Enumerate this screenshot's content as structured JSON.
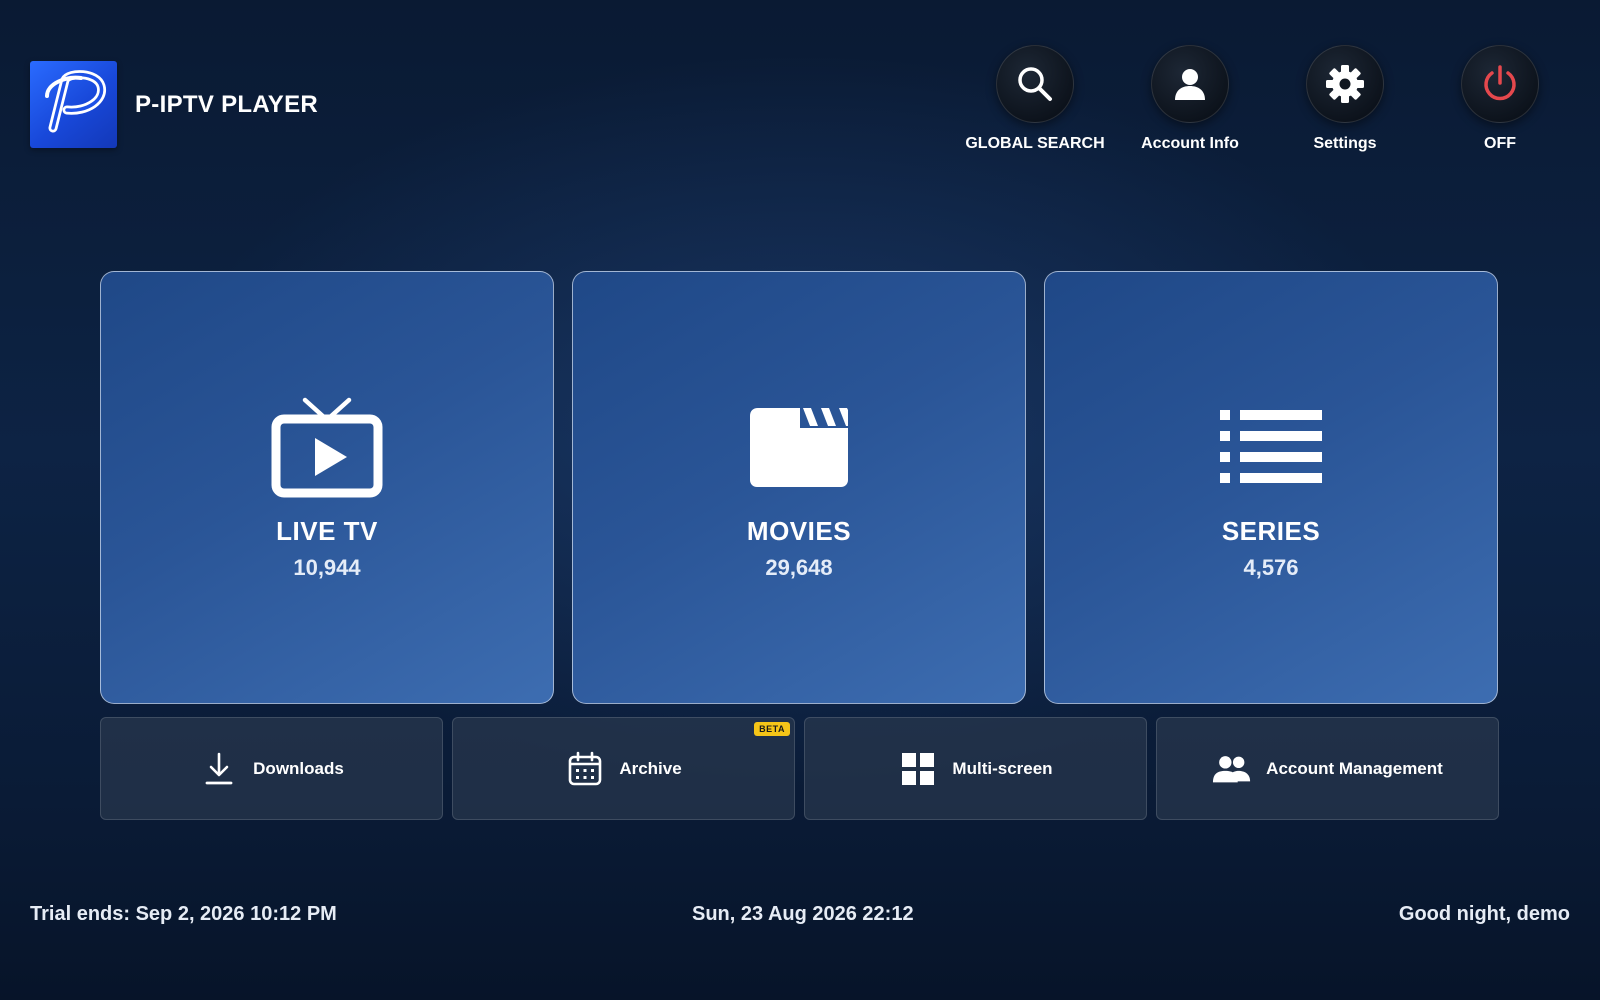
{
  "app": {
    "title": "P-IPTV PLAYER",
    "logo_letter": "P",
    "brand_color": "#1e52e6"
  },
  "header_actions": [
    {
      "label": "GLOBAL SEARCH",
      "icon": "search-icon"
    },
    {
      "label": "Account Info",
      "icon": "user-icon"
    },
    {
      "label": "Settings",
      "icon": "gear-icon"
    },
    {
      "label": "OFF",
      "icon": "power-icon",
      "color": "#e5484d"
    }
  ],
  "categories": [
    {
      "title": "LIVE TV",
      "count": "10,944",
      "icon": "tv-icon"
    },
    {
      "title": "MOVIES",
      "count": "29,648",
      "icon": "clapperboard-icon"
    },
    {
      "title": "SERIES",
      "count": "4,576",
      "icon": "list-icon"
    }
  ],
  "tiles": [
    {
      "label": "Downloads",
      "icon": "download-icon"
    },
    {
      "label": "Archive",
      "icon": "calendar-icon",
      "badge": "BETA"
    },
    {
      "label": "Multi-screen",
      "icon": "grid-icon"
    },
    {
      "label": "Account Management",
      "icon": "users-icon"
    }
  ],
  "footer": {
    "trial": "Trial ends: Sep 2, 2026 10:12 PM",
    "datetime": "Sun, 23 Aug 2026 22:12",
    "greeting": "Good night, demo"
  },
  "colors": {
    "card_gradient_start": "#1f4887",
    "card_gradient_end": "#3d6db1",
    "badge": "#f5c518",
    "power": "#e5484d"
  }
}
